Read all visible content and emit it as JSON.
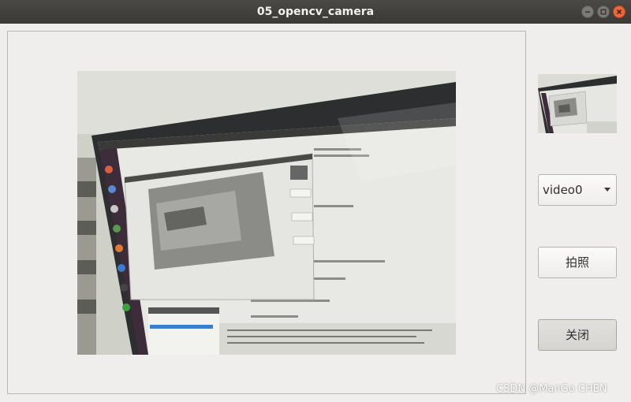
{
  "window": {
    "title": "05_opencv_camera"
  },
  "camera": {
    "device_options_selected": "video0"
  },
  "buttons": {
    "capture_label": "拍照",
    "close_label": "关闭"
  },
  "watermark": "CSDN @ManGo CHEN",
  "icons": {
    "minimize": "minimize-icon",
    "maximize": "maximize-icon",
    "close": "close-icon",
    "dropdown": "chevron-down-icon"
  },
  "colors": {
    "titlebar": "#3c3b37",
    "window_bg": "#efeeec",
    "close_button": "#e9683f"
  }
}
